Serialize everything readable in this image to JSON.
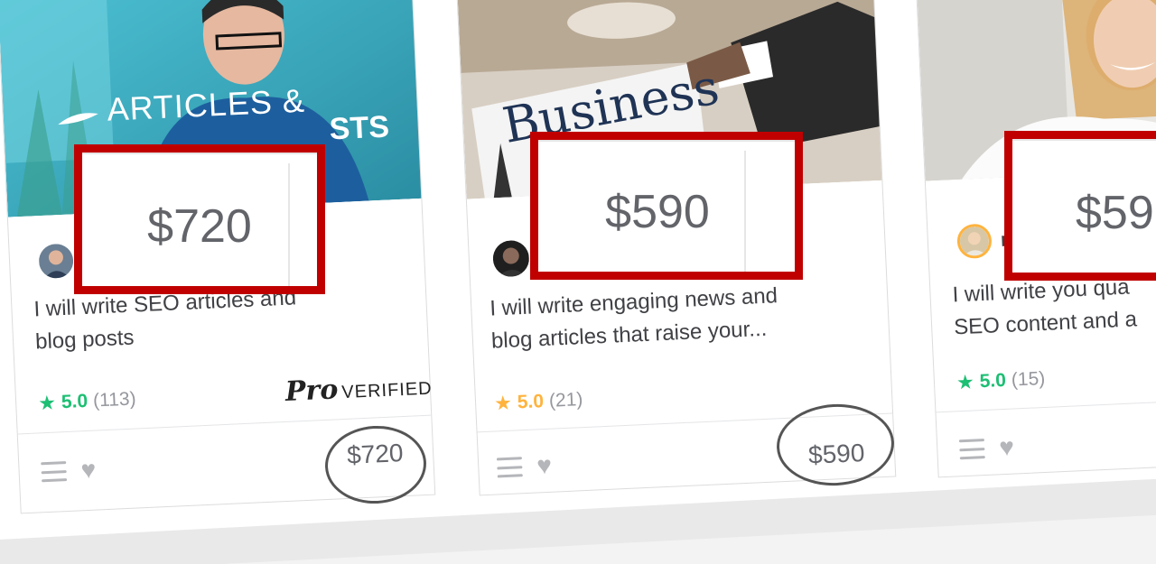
{
  "colors": {
    "highlight_box": "#c00000",
    "oval": "#555555",
    "star_teal": "#1dbf73",
    "star_gold": "#ffb33e",
    "text": "#404145",
    "muted": "#95979d"
  },
  "cards": [
    {
      "thumbnail_text_top": "ARTICLES &",
      "thumbnail_text_bottom": "STS",
      "title": "I will write SEO articles and blog posts",
      "title_line1": "I will write SEO articles and",
      "title_line2": "blog posts",
      "rating_score": "5.0",
      "rating_count": "(113)",
      "star_color": "teal",
      "badge_pro": "Pro",
      "badge_verified": "VERIFIED",
      "price": "$720",
      "highlight_price": "$720",
      "icons": [
        "menu-icon",
        "heart-icon",
        "star-icon"
      ]
    },
    {
      "thumbnail_text_top": "Business",
      "title_line1": "I will write engaging news and",
      "title_line2": "blog articles that raise your...",
      "rating_score": "5.0",
      "rating_count": "(21)",
      "star_color": "gold",
      "price": "$590",
      "highlight_price": "$590",
      "icons": [
        "menu-icon",
        "heart-icon",
        "star-icon"
      ]
    },
    {
      "seller_initial": "m",
      "title_line1": "I will write you qua",
      "title_line2": "SEO content and a",
      "rating_score": "5.0",
      "rating_count": "(15)",
      "star_color": "teal",
      "highlight_price": "$59",
      "icons": [
        "menu-icon",
        "heart-icon",
        "star-icon"
      ]
    }
  ]
}
